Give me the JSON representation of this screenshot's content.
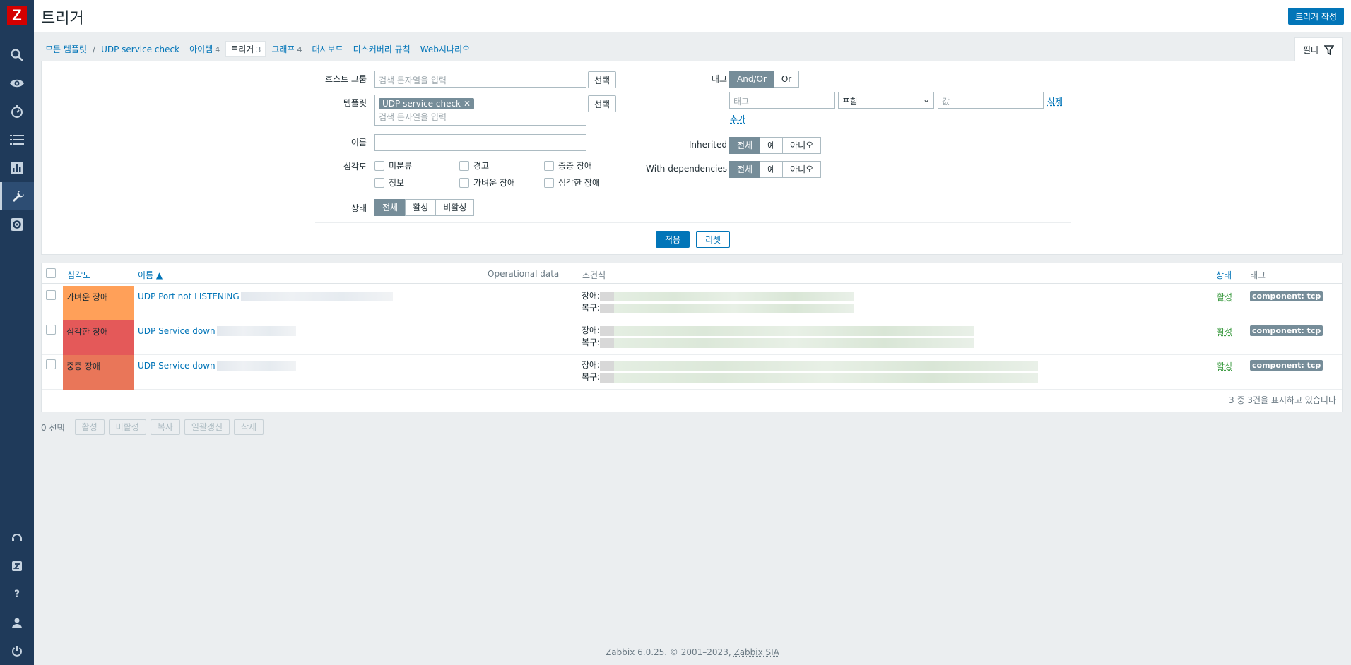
{
  "header": {
    "title": "트리거",
    "create_button": "트리거 작성"
  },
  "breadcrumb": {
    "all_templates": "모든 템플릿",
    "separator": "/",
    "template": "UDP service check",
    "tabs": [
      {
        "label": "아이템",
        "count": "4"
      },
      {
        "label": "트리거",
        "count": "3"
      },
      {
        "label": "그래프",
        "count": "4"
      },
      {
        "label": "대시보드",
        "count": ""
      },
      {
        "label": "디스커버리 규칙",
        "count": ""
      },
      {
        "label": "Web시나리오",
        "count": ""
      }
    ]
  },
  "filter": {
    "tab_label": "필터",
    "host_group": {
      "label": "호스트 그룹",
      "placeholder": "검색 문자열을 입력",
      "select": "선택"
    },
    "template": {
      "label": "템플릿",
      "chip": "UDP service check",
      "placeholder": "검색 문자열을 입력",
      "select": "선택"
    },
    "name": {
      "label": "이름",
      "value": ""
    },
    "severity": {
      "label": "심각도",
      "options": [
        "미분류",
        "경고",
        "중증 장애",
        "정보",
        "가벼운 장애",
        "심각한 장애"
      ]
    },
    "state": {
      "label": "상태",
      "options": [
        "전체",
        "활성",
        "비활성"
      ],
      "selected": "전체"
    },
    "tags": {
      "label": "태그",
      "mode_options": [
        "And/Or",
        "Or"
      ],
      "mode_selected": "And/Or",
      "tag_placeholder": "태그",
      "operator": "포함",
      "value_placeholder": "값",
      "remove": "삭제",
      "add": "추가"
    },
    "inherited": {
      "label": "Inherited",
      "options": [
        "전체",
        "예",
        "아니오"
      ],
      "selected": "전체"
    },
    "dependencies": {
      "label": "With dependencies",
      "options": [
        "전체",
        "예",
        "아니오"
      ],
      "selected": "전체"
    },
    "apply": "적용",
    "reset": "리셋"
  },
  "table": {
    "headers": {
      "severity": "심각도",
      "name": "이름 ▲",
      "opdata": "Operational data",
      "expression": "조건식",
      "status": "상태",
      "tags": "태그"
    },
    "rows": [
      {
        "severity": "가벼운 장애",
        "color": "#ffa059",
        "name": "UDP Port not LISTENING",
        "problem": "장애:",
        "recovery": "복구:",
        "status": "활성",
        "tag": "component: tcp"
      },
      {
        "severity": "심각한 장애",
        "color": "#e45959",
        "name": "UDP Service down",
        "problem": "장애:",
        "recovery": "복구:",
        "status": "활성",
        "tag": "component: tcp"
      },
      {
        "severity": "중증 장애",
        "color": "#e97659",
        "name": "UDP Service down",
        "problem": "장애:",
        "recovery": "복구:",
        "status": "활성",
        "tag": "component: tcp"
      }
    ],
    "count_text": "3 중 3건을 표시하고 있습니다"
  },
  "bulk": {
    "selected": "0 선택",
    "buttons": [
      "활성",
      "비활성",
      "복사",
      "일괄갱신",
      "삭제"
    ]
  },
  "footer": {
    "text": "Zabbix 6.0.25. © 2001–2023,",
    "link": "Zabbix SIA"
  },
  "sidebar": {
    "logo": "Z",
    "icons": [
      "search-icon",
      "eye-icon",
      "stopwatch-icon",
      "list-icon",
      "chart-icon",
      "wrench-icon",
      "gear-icon"
    ],
    "bottom_icons": [
      "support-icon",
      "zabbix-share-icon",
      "help-icon",
      "user-icon",
      "power-icon"
    ]
  }
}
